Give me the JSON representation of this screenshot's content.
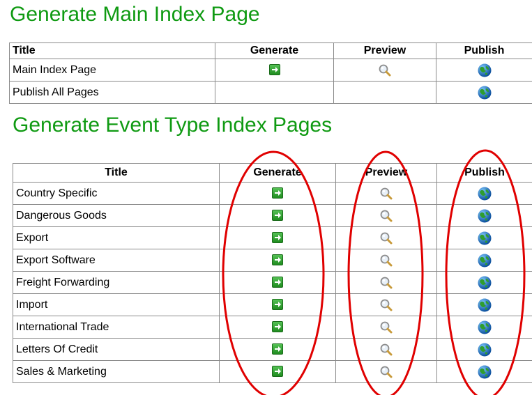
{
  "main_section": {
    "title": "Generate Main Index Page",
    "columns": {
      "title": "Title",
      "generate": "Generate",
      "preview": "Preview",
      "publish": "Publish"
    },
    "rows": [
      {
        "title": "Main Index Page",
        "generate": true,
        "preview": true,
        "publish": true
      },
      {
        "title": "Publish All Pages",
        "generate": false,
        "preview": false,
        "publish": true
      }
    ]
  },
  "event_section": {
    "title": "Generate Event Type Index Pages",
    "columns": {
      "title": "Title",
      "generate": "Generate",
      "preview": "Preview",
      "publish": "Publish"
    },
    "rows": [
      {
        "title": "Country Specific"
      },
      {
        "title": "Dangerous Goods"
      },
      {
        "title": "Export"
      },
      {
        "title": "Export Software"
      },
      {
        "title": "Freight Forwarding"
      },
      {
        "title": "Import"
      },
      {
        "title": "International Trade"
      },
      {
        "title": "Letters Of Credit"
      },
      {
        "title": "Sales & Marketing"
      }
    ]
  },
  "icons": {
    "generate": "green-arrow-icon",
    "preview": "magnifier-icon",
    "publish": "globe-icon"
  },
  "colors": {
    "heading": "#0f9a12",
    "annotation": "#e00000",
    "border": "#8a8a8a"
  }
}
